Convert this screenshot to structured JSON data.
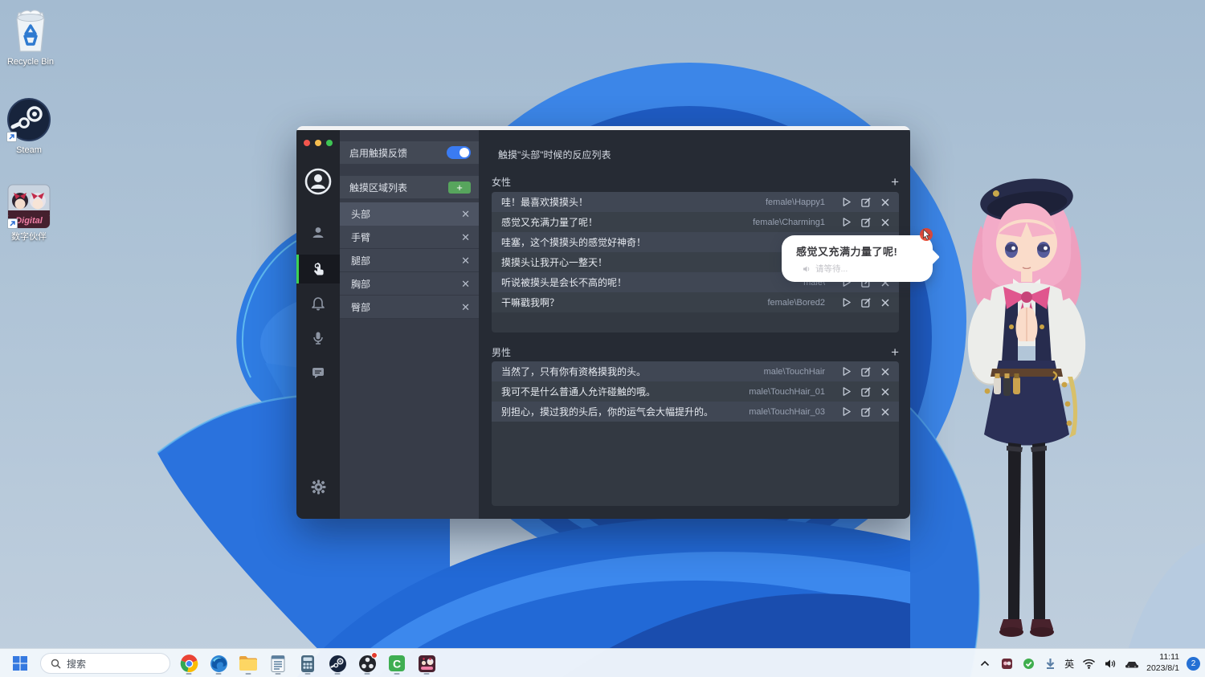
{
  "colors": {
    "accent_blue": "#3a7bf2",
    "green_add": "#57a55d",
    "active_green_bar": "#3ed152",
    "window_dark": "#262b34",
    "bloom_blue": "#2a72dd",
    "taskbar_bg": "#f1f6fb"
  },
  "desktop": {
    "icons": [
      {
        "name": "recycle-bin",
        "label": "Recycle Bin"
      },
      {
        "name": "steam",
        "label": "Steam"
      },
      {
        "name": "digital-mate",
        "label": "数字伙伴",
        "art_text": "Digital"
      }
    ]
  },
  "window": {
    "sidebar": {
      "items": [
        {
          "name": "user-avatar",
          "active": false
        },
        {
          "name": "person",
          "active": false
        },
        {
          "name": "touch",
          "active": true
        },
        {
          "name": "notification-bell",
          "active": false
        },
        {
          "name": "microphone",
          "active": false
        },
        {
          "name": "chat",
          "active": false
        },
        {
          "name": "settings-gear",
          "active": false
        }
      ]
    },
    "panel": {
      "enable_label": "启用触摸反馈",
      "toggle_on": true,
      "list_header": "触摸区域列表",
      "areas": [
        {
          "label": "头部",
          "active": true
        },
        {
          "label": "手臂",
          "active": false
        },
        {
          "label": "腿部",
          "active": false
        },
        {
          "label": "胸部",
          "active": false
        },
        {
          "label": "臀部",
          "active": false
        }
      ]
    },
    "main": {
      "title": "触摸\"头部\"时候的反应列表",
      "sections": [
        {
          "title": "女性",
          "rows": [
            {
              "text": "哇！最喜欢摸摸头！",
              "voice": "female\\Happy1"
            },
            {
              "text": "感觉又充满力量了呢！",
              "voice": "female\\Charming1"
            },
            {
              "text": "哇塞，这个摸摸头的感觉好神奇！",
              "voice": ""
            },
            {
              "text": "摸摸头让我开心一整天！",
              "voice": ""
            },
            {
              "text": "听说被摸头是会长不高的呢！",
              "voice": "male\\"
            },
            {
              "text": "干嘛戳我啊？",
              "voice": "female\\Bored2"
            }
          ]
        },
        {
          "title": "男性",
          "rows": [
            {
              "text": "当然了，只有你有资格摸我的头。",
              "voice": "male\\TouchHair"
            },
            {
              "text": "我可不是什么普通人允许碰触的哦。",
              "voice": "male\\TouchHair_01"
            },
            {
              "text": "别担心，摸过我的头后，你的运气会大幅提升的。",
              "voice": "male\\TouchHair_03"
            }
          ]
        }
      ]
    }
  },
  "bubble": {
    "text": "感觉又充满力量了呢!",
    "status": "请等待..."
  },
  "taskbar": {
    "search": {
      "label": "搜索"
    },
    "apps": [
      "chrome",
      "edge",
      "file-explorer",
      "notepad",
      "calculator",
      "steam",
      "obs",
      "clash",
      "digital-mate"
    ],
    "tray": {
      "icons": [
        "chevron-up",
        "tray-app",
        "sync-ok",
        "download",
        "ime",
        "wifi",
        "volume",
        "device"
      ],
      "ime_label": "英",
      "time": "11:11",
      "date": "2023/8/1",
      "notification_count": "2"
    }
  }
}
